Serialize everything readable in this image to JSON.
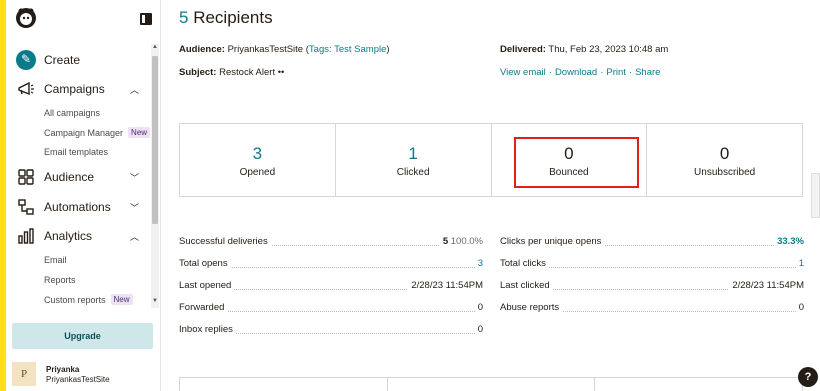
{
  "sidebar": {
    "create": "Create",
    "campaigns": "Campaigns",
    "campaign_items": [
      "All campaigns",
      "Campaign Manager",
      "Email templates"
    ],
    "new_badge": "New",
    "audience": "Audience",
    "automations": "Automations",
    "analytics": "Analytics",
    "analytics_items": [
      "Email",
      "Reports",
      "Custom reports"
    ],
    "upgrade": "Upgrade",
    "user": {
      "initial": "P",
      "name": "Priyanka",
      "org": "PriyankasTestSite"
    }
  },
  "header": {
    "count": "5",
    "title_suffix": "Recipients"
  },
  "meta": {
    "audience_label": "Audience:",
    "audience_value": "PriyankasTestSite",
    "tags_label": "Tags:",
    "tags_value": "Test Sample",
    "subject_label": "Subject:",
    "subject_value": "Restock Alert ••",
    "delivered_label": "Delivered:",
    "delivered_value": "Thu, Feb 23, 2023 10:48 am",
    "links": [
      "View email",
      "Download",
      "Print",
      "Share"
    ]
  },
  "stats": [
    {
      "value": "3",
      "label": "Opened"
    },
    {
      "value": "1",
      "label": "Clicked"
    },
    {
      "value": "0",
      "label": "Bounced"
    },
    {
      "value": "0",
      "label": "Unsubscribed"
    }
  ],
  "left_table": [
    {
      "label": "Successful deliveries",
      "value": "5",
      "extra": "100.0%"
    },
    {
      "label": "Total opens",
      "value": "3"
    },
    {
      "label": "Last opened",
      "value": "2/28/23 11:54PM"
    },
    {
      "label": "Forwarded",
      "value": "0"
    },
    {
      "label": "Inbox replies",
      "value": "0"
    }
  ],
  "right_table": [
    {
      "label": "Clicks per unique opens",
      "value": "33.3%"
    },
    {
      "label": "Total clicks",
      "value": "1"
    },
    {
      "label": "Last clicked",
      "value": "2/28/23 11:54PM"
    },
    {
      "label": "Abuse reports",
      "value": "0"
    }
  ],
  "help": "?"
}
